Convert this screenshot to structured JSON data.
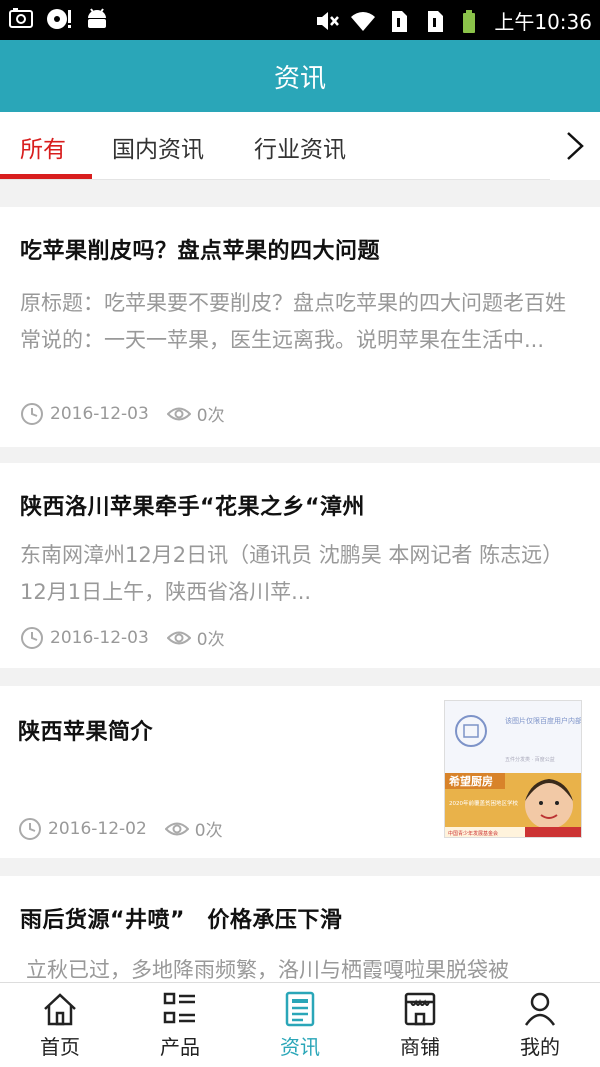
{
  "status_bar": {
    "time": "上午10:36",
    "icons": [
      "screenshot-icon",
      "disc-alert-icon",
      "android-icon",
      "mute-icon",
      "wifi-icon",
      "sim1-icon",
      "sim2-icon",
      "battery-icon"
    ]
  },
  "header": {
    "title": "资讯"
  },
  "tabs": [
    {
      "label": "所有",
      "active": true
    },
    {
      "label": "国内资讯",
      "active": false
    },
    {
      "label": "行业资讯",
      "active": false
    }
  ],
  "articles": [
    {
      "title": "吃苹果削皮吗？盘点苹果的四大问题",
      "desc": "原标题：吃苹果要不要削皮？盘点吃苹果的四大问题老百姓常说的：一天一苹果，医生远离我。说明苹果在生活中...",
      "date": "2016-12-03",
      "views": "0次"
    },
    {
      "title": "陕西洛川苹果牵手“花果之乡“漳州",
      "desc": "东南网漳州12月2日讯（通讯员 沈鹏昊 本网记者 陈志远） 12月1日上午，陕西省洛川苹...",
      "date": "2016-12-03",
      "views": "0次"
    },
    {
      "title": "陕西苹果简介",
      "date": "2016-12-02",
      "views": "0次",
      "thumb": {
        "top_text": "该图片仅限百度用户内部交流使用",
        "sub_text": "五件分发类 · 百度公益",
        "banner_title": "希望厨房",
        "banner_line": "2020年前覆盖贫困地区学校",
        "org": "中国青少年发展基金会"
      }
    },
    {
      "title": "雨后货源“井喷”　价格承压下滑",
      "desc": "立秋已过，多地降雨频繁，洛川与栖霞嘎啦果脱袋被"
    }
  ],
  "bottom_nav": [
    {
      "label": "首页",
      "icon": "home-icon",
      "active": false
    },
    {
      "label": "产品",
      "icon": "grid-list-icon",
      "active": false
    },
    {
      "label": "资讯",
      "icon": "news-icon",
      "active": true
    },
    {
      "label": "商铺",
      "icon": "shop-icon",
      "active": false
    },
    {
      "label": "我的",
      "icon": "user-icon",
      "active": false
    }
  ],
  "colors": {
    "accent": "#2aa6b8",
    "tab_active": "#d81e1e",
    "muted": "#999999"
  }
}
